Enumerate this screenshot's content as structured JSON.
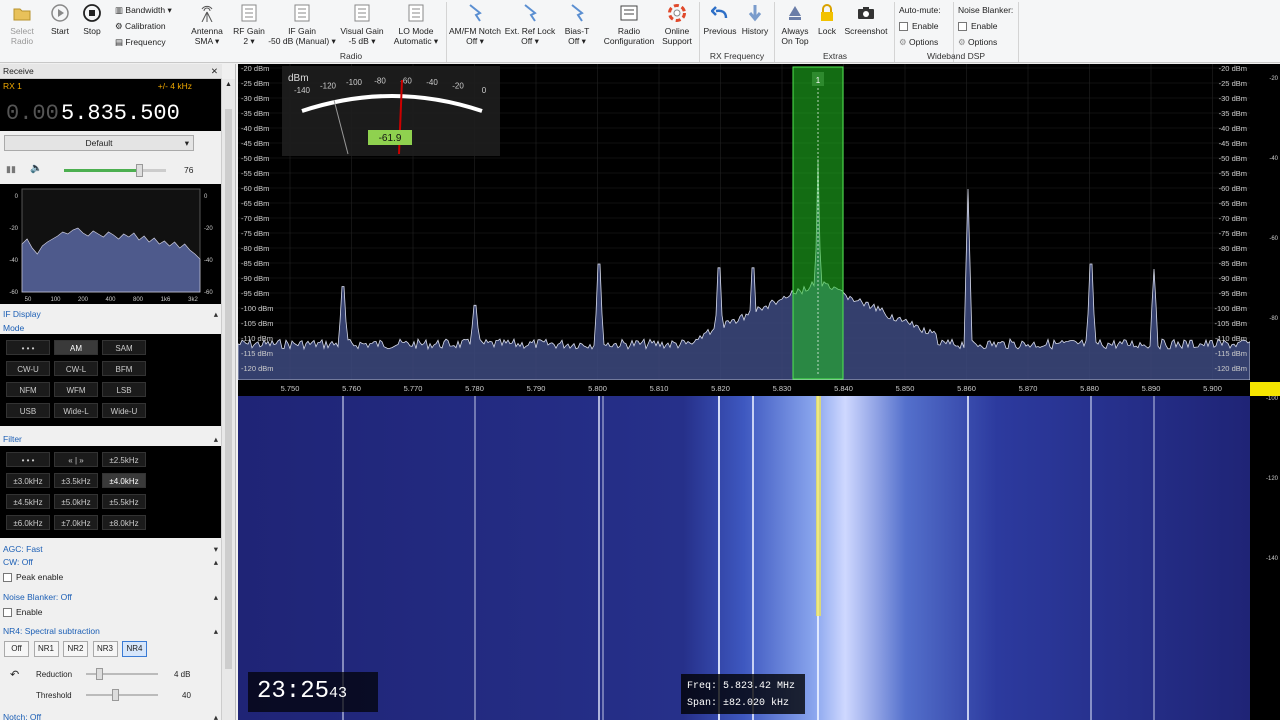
{
  "ribbon": {
    "select_radio": [
      "Select",
      "Radio"
    ],
    "start": "Start",
    "stop": "Stop",
    "bandwidth": "Bandwidth",
    "calibration": "Calibration",
    "frequency": "Frequency",
    "antenna": [
      "Antenna",
      "SMA ▾"
    ],
    "rf_gain": [
      "RF Gain",
      "2 ▾"
    ],
    "if_gain": [
      "IF Gain",
      "-50 dB (Manual) ▾"
    ],
    "visual_gain": [
      "Visual Gain",
      "-5 dB ▾"
    ],
    "lo_mode": [
      "LO Mode",
      "Automatic ▾"
    ],
    "amfm_notch": [
      "AM/FM Notch",
      "Off ▾"
    ],
    "ext_ref": [
      "Ext. Ref Lock",
      "Off ▾"
    ],
    "bias_t": [
      "Bias-T",
      "Off ▾"
    ],
    "radio_config": [
      "Radio",
      "Configuration"
    ],
    "online_support": [
      "Online",
      "Support"
    ],
    "previous": "Previous",
    "history": "History",
    "always_on_top": [
      "Always",
      "On Top"
    ],
    "lock": "Lock",
    "screenshot": "Screenshot",
    "auto_mute": "Auto-mute:",
    "noise_blanker": "Noise Blanker:",
    "enable": "Enable",
    "options": "Options",
    "groups": {
      "radio": "Radio",
      "rx_frequency": "RX Frequency",
      "extras": "Extras",
      "wideband": "Wideband DSP"
    }
  },
  "receive": {
    "title": "Receive",
    "rx": "RX 1",
    "offset": "+/- 4 kHz",
    "freq_dim": "0.00",
    "freq_main": "5.835.500",
    "profile": "Default",
    "volume": "76"
  },
  "audio_scope": {
    "y_labels": [
      "0",
      "-20",
      "-40",
      "-60"
    ],
    "x_labels": [
      "50",
      "100",
      "200",
      "400",
      "800",
      "1k6",
      "3k2"
    ]
  },
  "if_display": "IF Display",
  "mode": {
    "title": "Mode",
    "buttons": [
      "• • •",
      "AM",
      "SAM",
      "CW-U",
      "CW-L",
      "BFM",
      "NFM",
      "WFM",
      "LSB",
      "USB",
      "Wide-L",
      "Wide-U"
    ],
    "active": "AM"
  },
  "filter": {
    "title": "Filter",
    "buttons": [
      "• • •",
      "« | »",
      "±2.5kHz",
      "±3.0kHz",
      "±3.5kHz",
      "±4.0kHz",
      "±4.5kHz",
      "±5.0kHz",
      "±5.5kHz",
      "±6.0kHz",
      "±7.0kHz",
      "±8.0kHz"
    ],
    "active": "±4.0kHz"
  },
  "agc": "AGC: Fast",
  "cw": "CW: Off",
  "peak_enable": "Peak enable",
  "nb": "Noise Blanker: Off",
  "nb_enable": "Enable",
  "nr4": {
    "title": "NR4: Spectral subtraction",
    "buttons": [
      "Off",
      "NR1",
      "NR2",
      "NR3",
      "NR4"
    ],
    "active": "NR4",
    "reduction_label": "Reduction",
    "reduction": "4 dB",
    "threshold_label": "Threshold",
    "threshold": "40"
  },
  "notch": "Notch: Off",
  "spectrum": {
    "db_labels": [
      "-20 dBm",
      "-25 dBm",
      "-30 dBm",
      "-35 dBm",
      "-40 dBm",
      "-45 dBm",
      "-50 dBm",
      "-55 dBm",
      "-60 dBm",
      "-65 dBm",
      "-70 dBm",
      "-75 dBm",
      "-80 dBm",
      "-85 dBm",
      "-90 dBm",
      "-95 dBm",
      "-100 dBm",
      "-105 dBm",
      "-110 dBm",
      "-115 dBm",
      "-120 dBm"
    ],
    "freq_labels": [
      "5.750",
      "5.760",
      "5.770",
      "5.780",
      "5.790",
      "5.800",
      "5.810",
      "5.820",
      "5.830",
      "5.840",
      "5.850",
      "5.860",
      "5.870",
      "5.880",
      "5.890",
      "5.900"
    ],
    "meter_unit": "dBm",
    "meter_scale": [
      "-140",
      "-120",
      "-100",
      "-80",
      "-60",
      "-40",
      "-20",
      "0"
    ],
    "meter_value": "-61.9",
    "channel": "1"
  },
  "wf_scale": [
    "-20",
    "-40",
    "-60",
    "-80",
    "-100",
    "-120",
    "-140"
  ],
  "clock": {
    "hm": "23:25",
    "s": "43"
  },
  "cursor": {
    "freq_label": "Freq:",
    "freq": "5.823.42 MHz",
    "span_label": "Span:",
    "span": "±82.020 kHz"
  },
  "colors": {
    "accent": "#1c5fb5",
    "spectrum_fill": "#4b5a8e",
    "waterfall": "#1a1e6e",
    "channel": "#22c422",
    "meter_badge": "#8fd14f"
  }
}
